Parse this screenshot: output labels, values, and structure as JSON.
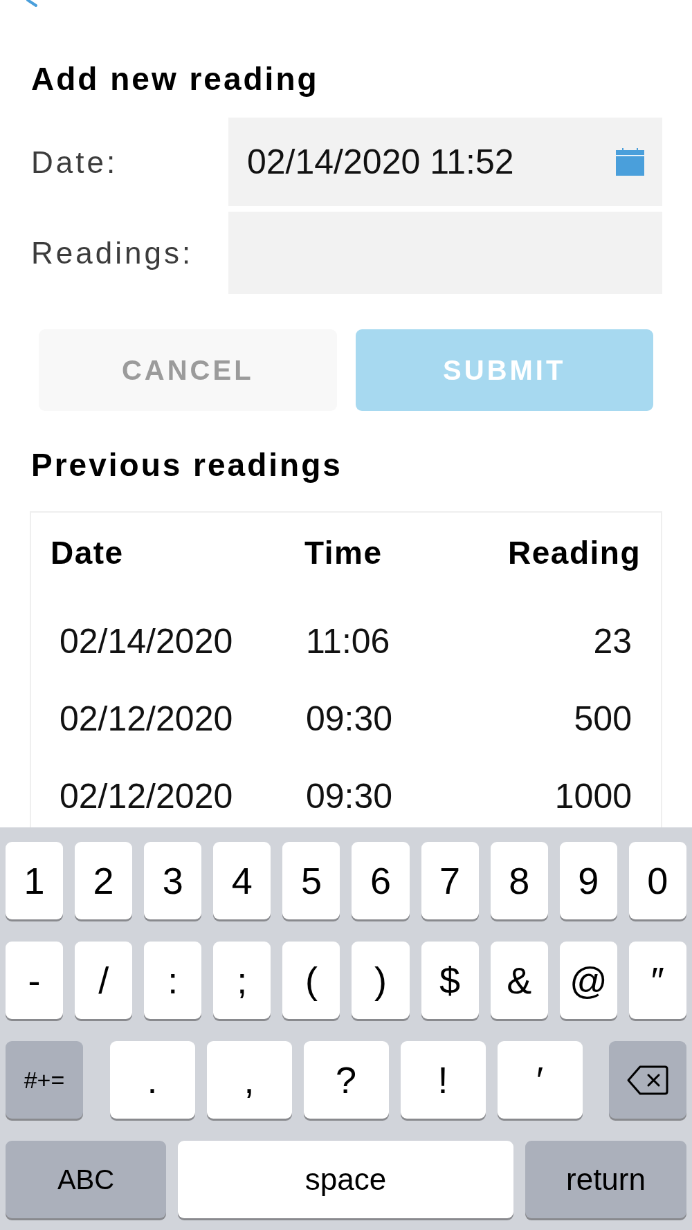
{
  "form": {
    "title": "Add new reading",
    "fields": [
      {
        "kind": "date",
        "label": "Date:",
        "value": "02/14/2020 11:52"
      },
      {
        "kind": "number",
        "label": "Readings:"
      }
    ],
    "buttons": [
      {
        "kind": "cancel",
        "label": "CANCEL"
      },
      {
        "kind": "submit",
        "label": "SUBMIT"
      }
    ]
  },
  "previous_readings": {
    "title": "Previous readings",
    "columns": [
      "Date",
      "Time",
      "Reading"
    ],
    "rows": [
      [
        "02/14/2020",
        "11:06",
        "23"
      ],
      [
        "02/12/2020",
        "09:30",
        "500"
      ],
      [
        "02/12/2020",
        "09:30",
        "1000"
      ]
    ]
  },
  "keyboard": {
    "rows": [
      {
        "keys": [
          {
            "kind": "char",
            "label": "1"
          },
          {
            "kind": "char",
            "label": "2"
          },
          {
            "kind": "char",
            "label": "3"
          },
          {
            "kind": "char",
            "label": "4"
          },
          {
            "kind": "char",
            "label": "5"
          },
          {
            "kind": "char",
            "label": "6"
          },
          {
            "kind": "char",
            "label": "7"
          },
          {
            "kind": "char",
            "label": "8"
          },
          {
            "kind": "char",
            "label": "9"
          },
          {
            "kind": "char",
            "label": "0"
          }
        ]
      },
      {
        "keys": [
          {
            "kind": "char",
            "label": "-"
          },
          {
            "kind": "char",
            "label": "/"
          },
          {
            "kind": "char",
            "label": ":"
          },
          {
            "kind": "char",
            "label": ";"
          },
          {
            "kind": "char",
            "label": "("
          },
          {
            "kind": "char",
            "label": ")"
          },
          {
            "kind": "char",
            "label": "$"
          },
          {
            "kind": "char",
            "label": "&"
          },
          {
            "kind": "char",
            "label": "@"
          },
          {
            "kind": "char",
            "label": "″"
          }
        ]
      },
      {
        "keys": [
          {
            "kind": "more",
            "label": "#+="
          },
          {
            "kind": "char",
            "label": "."
          },
          {
            "kind": "char",
            "label": ","
          },
          {
            "kind": "char",
            "label": "?"
          },
          {
            "kind": "char",
            "label": "!"
          },
          {
            "kind": "char",
            "label": "′"
          },
          {
            "kind": "backspace"
          }
        ]
      },
      {
        "keys": [
          {
            "kind": "abc",
            "label": "ABC"
          },
          {
            "kind": "space",
            "label": "space"
          },
          {
            "kind": "return",
            "label": "return"
          }
        ]
      }
    ]
  }
}
